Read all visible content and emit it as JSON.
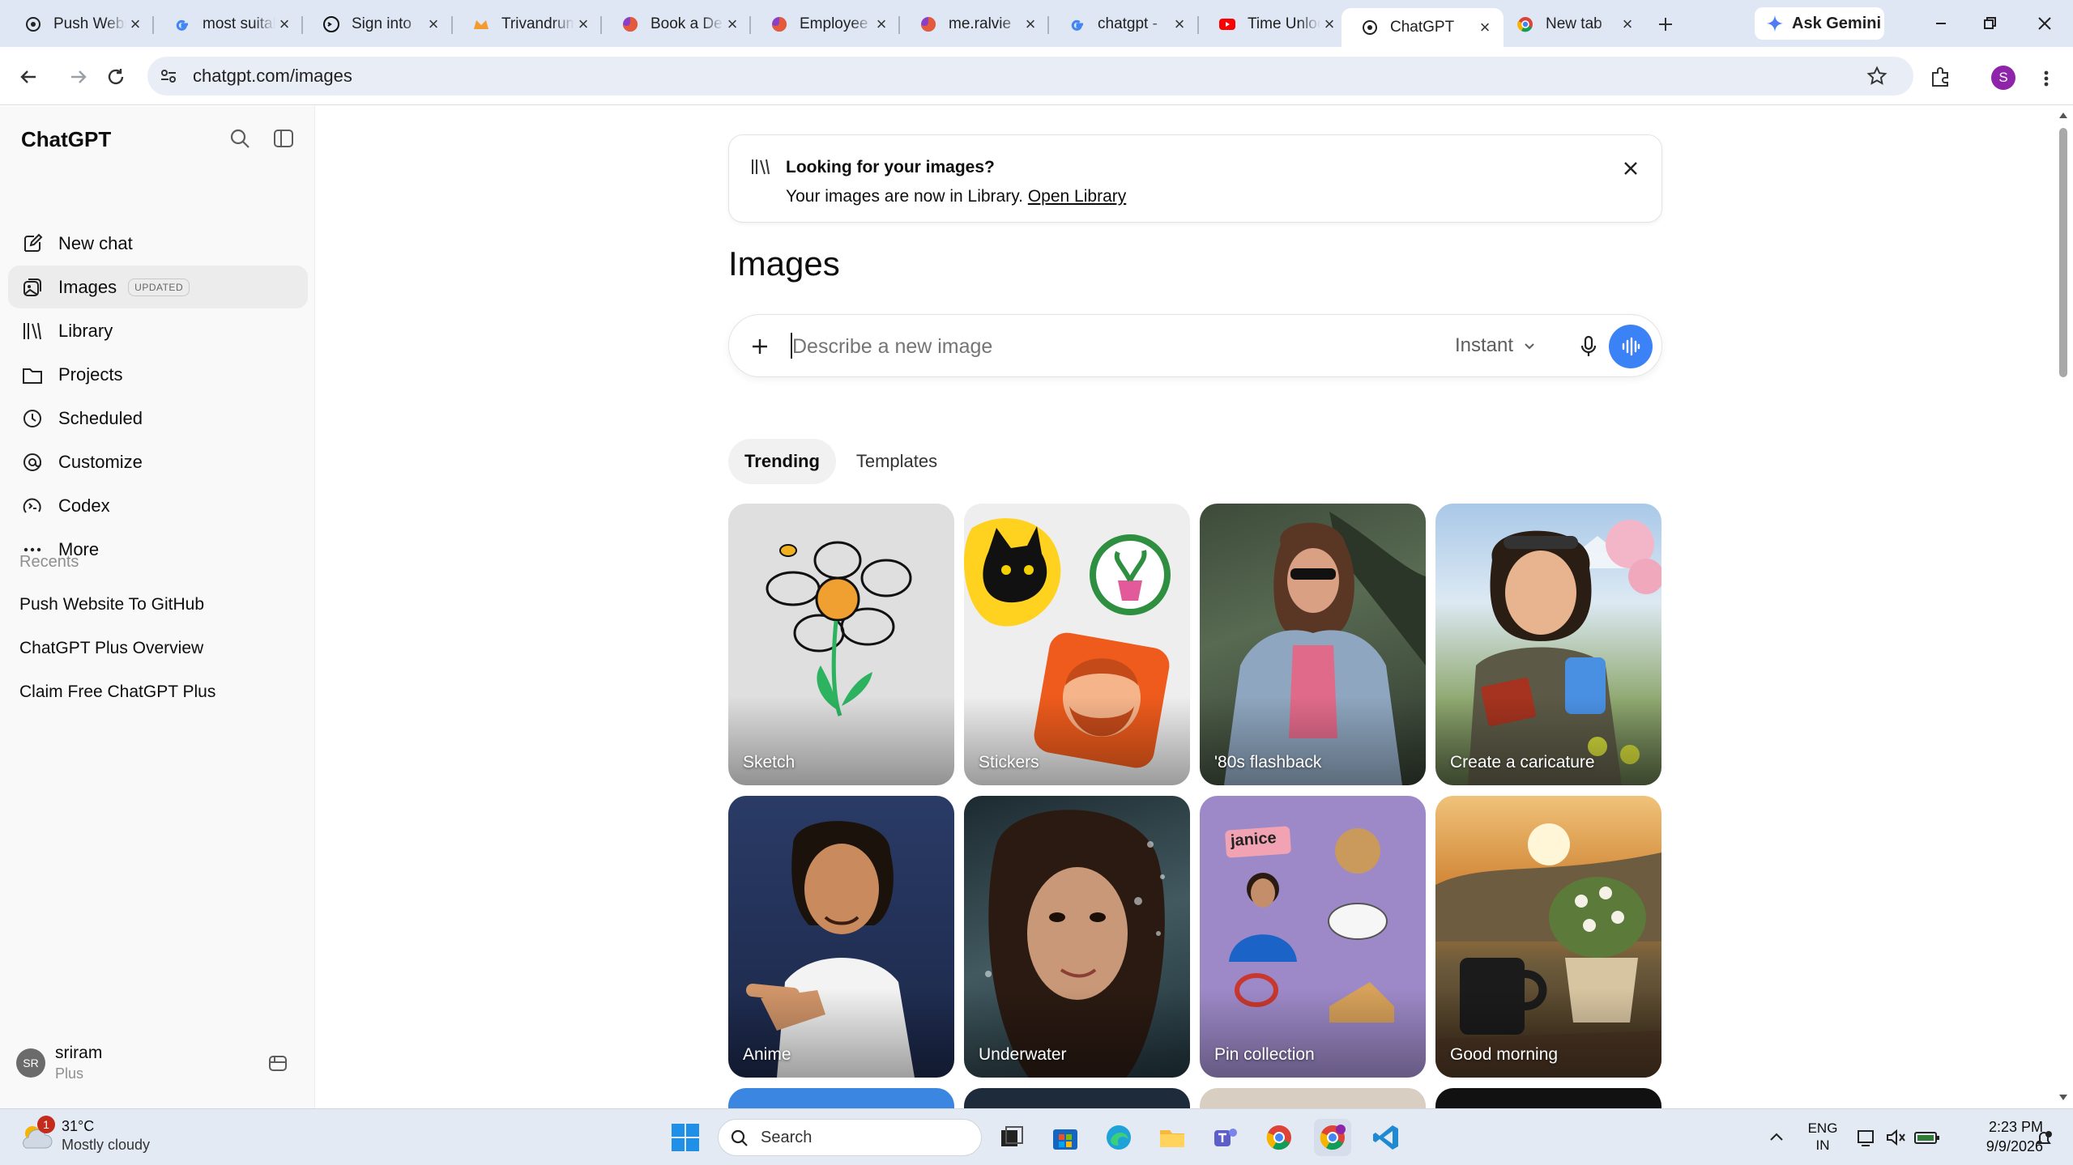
{
  "browser": {
    "tabs": [
      {
        "title": "Push Website",
        "favicon": "chatgpt-favicon"
      },
      {
        "title": "most suitable",
        "favicon": "google-favicon"
      },
      {
        "title": "Sign into",
        "favicon": "github-favicon"
      },
      {
        "title": "Trivandrum",
        "favicon": "crown-favicon"
      },
      {
        "title": "Book a Demo",
        "favicon": "firefox-favicon"
      },
      {
        "title": "Employee",
        "favicon": "firefox-favicon"
      },
      {
        "title": "me.ralvie",
        "favicon": "firefox-favicon"
      },
      {
        "title": "chatgpt -",
        "favicon": "google-favicon"
      },
      {
        "title": "Time Unlock",
        "favicon": "youtube-favicon"
      },
      {
        "title": "ChatGPT",
        "favicon": "chatgpt-favicon",
        "active": true
      },
      {
        "title": "New tab",
        "favicon": "chrome-favicon"
      }
    ],
    "ask_gemini": "Ask Gemini",
    "url": "chatgpt.com/images",
    "profile_initial": "S"
  },
  "sidebar": {
    "logo": "ChatGPT",
    "nav": [
      {
        "label": "New chat",
        "icon": "compose-icon"
      },
      {
        "label": "Images",
        "icon": "images-icon",
        "badge": "UPDATED",
        "selected": true
      },
      {
        "label": "Library",
        "icon": "library-icon"
      },
      {
        "label": "Projects",
        "icon": "folder-icon"
      },
      {
        "label": "Scheduled",
        "icon": "clock-icon"
      },
      {
        "label": "Customize",
        "icon": "customize-icon"
      },
      {
        "label": "Codex",
        "icon": "codex-icon"
      },
      {
        "label": "More",
        "icon": "more-icon"
      }
    ],
    "recents_heading": "Recents",
    "recents": [
      "Push Website To GitHub",
      "ChatGPT Plus Overview",
      "Claim Free ChatGPT Plus"
    ],
    "user": {
      "initials": "SR",
      "name": "sriram",
      "plan": "Plus"
    }
  },
  "banner": {
    "title": "Looking for your images?",
    "text": "Your images are now in Library.",
    "link": "Open Library"
  },
  "main": {
    "heading": "Images",
    "prompt_placeholder": "Describe a new image",
    "mode": "Instant",
    "tabs": [
      "Trending",
      "Templates"
    ],
    "cards": [
      "Sketch",
      "Stickers",
      "'80s flashback",
      "Create a caricature",
      "Anime",
      "Underwater",
      "Pin collection",
      "Good morning"
    ],
    "pin_text": "janice"
  },
  "taskbar": {
    "weather_temp": "31°C",
    "weather_desc": "Mostly cloudy",
    "weather_badge": "1",
    "search": "Search",
    "lang": "ENG",
    "region": "IN",
    "time": "2:23 PM",
    "date": "9/9/2026"
  },
  "colors": {
    "accent": "#3b82f6",
    "selected": "#ececec",
    "tabstrip": "#dfe7f5"
  }
}
